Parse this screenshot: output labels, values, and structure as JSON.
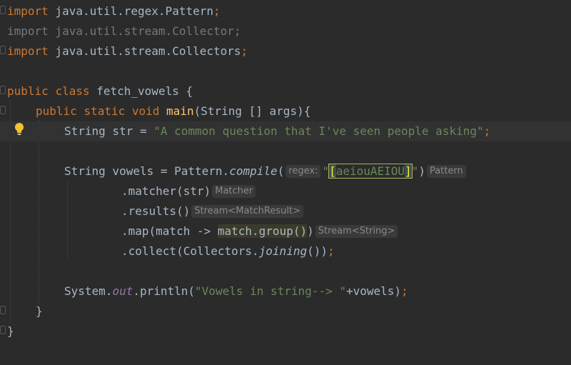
{
  "editor": {
    "language": "java",
    "lines": {
      "l1": {
        "kw": "import",
        "rest": " java.util.regex.Pattern",
        "semi": ";"
      },
      "l2": {
        "text": "import java.util.stream.Collector;"
      },
      "l3": {
        "kw": "import",
        "rest": " java.util.stream.Collectors",
        "semi": ";"
      },
      "l5": {
        "kw1": "public",
        "kw2": "class",
        "rest": " fetch_vowels {"
      },
      "l6": {
        "kw1": "public",
        "kw2": "static",
        "kw3": "void",
        "fn": "main",
        "rest": "(String [] args){"
      },
      "l7": {
        "pre": "String str = ",
        "str": "\"A common question that I've seen people asking\"",
        "semi": ";"
      },
      "l9": {
        "pre": "String vowels = Pattern.",
        "method": "compile",
        "paren_open": "(",
        "hint_regex": "regex:",
        "q1": "\"",
        "bracket_open": "[",
        "regex_body": "aeiouAEIOU",
        "bracket_close": "]",
        "q2": "\"",
        "paren_close": ")",
        "hint_type": "Pattern"
      },
      "l10": {
        "text": ".matcher(str)",
        "hint": "Matcher"
      },
      "l11": {
        "text": ".results()",
        "hint": "Stream<MatchResult>"
      },
      "l12": {
        "pre": ".map(match -> ",
        "hl": "match.group()",
        "post": ")",
        "hint": "Stream<String>"
      },
      "l13": {
        "pre": ".collect(Collectors.",
        "method": "joining",
        "post": "())",
        "semi": ";"
      },
      "l15": {
        "pre": "System.",
        "field": "out",
        "mid": ".println(",
        "str": "\"Vowels in string--> \"",
        "post": "+vowels)",
        "semi": ";"
      },
      "l16": {
        "text": "}"
      },
      "l17": {
        "text": "}"
      }
    },
    "colors": {
      "background": "#2b2b2b",
      "keyword": "#cc7832",
      "string": "#6a8759",
      "function": "#ffc66d",
      "static_field": "#9876aa",
      "default": "#a9b7c6"
    },
    "icons": {
      "intention": "lightbulb-icon"
    }
  }
}
